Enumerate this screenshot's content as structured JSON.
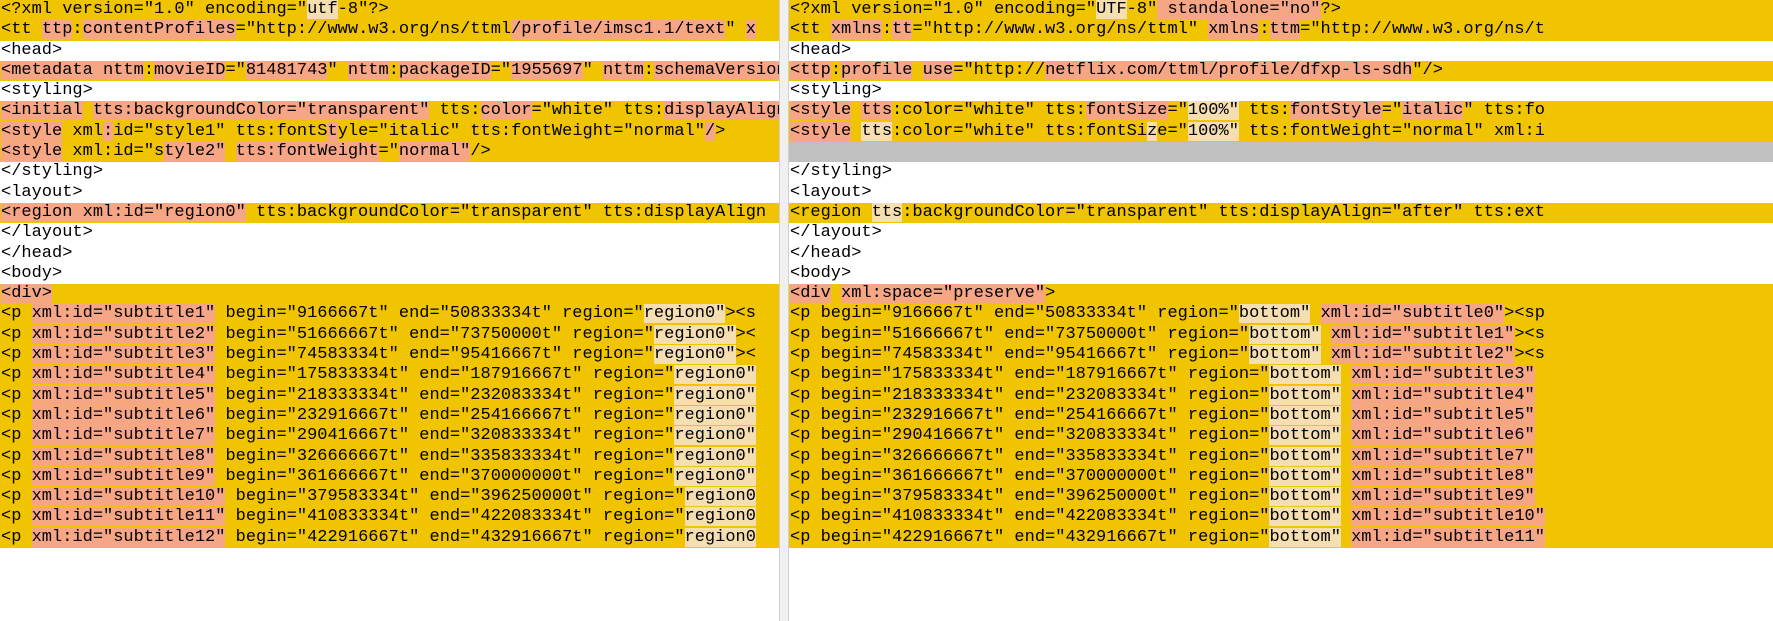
{
  "colors": {
    "changed_line": "#f0c400",
    "deleted_text": "#f6a585",
    "modified_text": "#f5deb0",
    "blank_line": "#c0c0c0",
    "background": "#ffffff"
  },
  "left_pane": {
    "lines": [
      {
        "s": "changed",
        "t": [
          [
            "n",
            "<?xml version=\"1.0\" encoding=\""
          ],
          [
            "m",
            "utf"
          ],
          [
            "n",
            "-8\"?>"
          ]
        ]
      },
      {
        "s": "changed",
        "t": [
          [
            "n",
            "<tt "
          ],
          [
            "d",
            "ttp"
          ],
          [
            "n",
            ":"
          ],
          [
            "d",
            "contentProfiles"
          ],
          [
            "n",
            "=\"http://www.w3.org/ns/ttml"
          ],
          [
            "d",
            "/profile/imsc1.1/text"
          ],
          [
            "n",
            "\" "
          ],
          [
            "d",
            "x"
          ]
        ]
      },
      {
        "s": "plain",
        "t": [
          [
            "n",
            "<head>"
          ]
        ]
      },
      {
        "s": "changed",
        "t": [
          [
            "d",
            "<metadata nttm"
          ],
          [
            "n",
            ":"
          ],
          [
            "d",
            "movieID"
          ],
          [
            "n",
            "=\""
          ],
          [
            "d",
            "81481743"
          ],
          [
            "n",
            "\" "
          ],
          [
            "d",
            "nttm"
          ],
          [
            "n",
            ":"
          ],
          [
            "d",
            "packageID"
          ],
          [
            "n",
            "=\""
          ],
          [
            "d",
            "1955697"
          ],
          [
            "n",
            "\" "
          ],
          [
            "d",
            "nttm"
          ],
          [
            "n",
            ":"
          ],
          [
            "d",
            "schemaVersion"
          ]
        ]
      },
      {
        "s": "plain",
        "t": [
          [
            "n",
            "<styling>"
          ]
        ]
      },
      {
        "s": "changed",
        "t": [
          [
            "d",
            "<initial"
          ],
          [
            "n",
            " "
          ],
          [
            "d",
            "tts:backgroundColor=\"transparent\""
          ],
          [
            "n",
            " tts:"
          ],
          [
            "d",
            "color"
          ],
          [
            "n",
            "=\"white\" tts:"
          ],
          [
            "d",
            "displayAlign"
          ]
        ]
      },
      {
        "s": "changed",
        "t": [
          [
            "d",
            "<style"
          ],
          [
            "n",
            " xml"
          ],
          [
            "d",
            ":"
          ],
          [
            "n",
            "id=\"style1\" tts:fontS"
          ],
          [
            "d",
            "t"
          ],
          [
            "n",
            "yle=\"italic\" tts:fontWeight=\"normal\""
          ],
          [
            "d",
            "/"
          ],
          [
            "n",
            ">"
          ]
        ]
      },
      {
        "s": "changed",
        "t": [
          [
            "d",
            "<style"
          ],
          [
            "n",
            " xml:id=\"s"
          ],
          [
            "d",
            "tyle2\""
          ],
          [
            "n",
            " "
          ],
          [
            "d",
            "tts:fontWeight"
          ],
          [
            "n",
            "=\""
          ],
          [
            "d",
            "normal\""
          ],
          [
            "n",
            "/>"
          ]
        ]
      },
      {
        "s": "plain",
        "t": [
          [
            "n",
            "</styling>"
          ]
        ]
      },
      {
        "s": "plain",
        "t": [
          [
            "n",
            "<layout>"
          ]
        ]
      },
      {
        "s": "changed",
        "t": [
          [
            "d",
            "<region xml:id=\"region0\""
          ],
          [
            "n",
            " tts:backgroundColor=\"transparent\" tts:displayAlign"
          ]
        ]
      },
      {
        "s": "plain",
        "t": [
          [
            "n",
            "</layout>"
          ]
        ]
      },
      {
        "s": "plain",
        "t": [
          [
            "n",
            "</head>"
          ]
        ]
      },
      {
        "s": "plain",
        "t": [
          [
            "n",
            "<body>"
          ]
        ]
      },
      {
        "s": "changed",
        "t": [
          [
            "d",
            "<div>"
          ]
        ]
      },
      {
        "s": "changed",
        "t": [
          [
            "n",
            "<p "
          ],
          [
            "d",
            "xml:id=\"subtitle1\""
          ],
          [
            "n",
            " begin=\"9166667t\" end=\"50833334t\" region=\""
          ],
          [
            "m",
            "region0\""
          ],
          [
            "n",
            "><s"
          ]
        ]
      },
      {
        "s": "changed",
        "t": [
          [
            "n",
            "<p "
          ],
          [
            "d",
            "xml:id=\"subtitle2\""
          ],
          [
            "n",
            " begin=\"51666667t\" end=\"73750000t\" region=\""
          ],
          [
            "m",
            "region0\""
          ],
          [
            "n",
            "><"
          ]
        ]
      },
      {
        "s": "changed",
        "t": [
          [
            "n",
            "<p "
          ],
          [
            "d",
            "xml:id=\"subtitle3\""
          ],
          [
            "n",
            " begin=\"74583334t\" end=\"95416667t\" region=\""
          ],
          [
            "m",
            "region0\""
          ],
          [
            "n",
            "><"
          ]
        ]
      },
      {
        "s": "changed",
        "t": [
          [
            "n",
            "<p "
          ],
          [
            "d",
            "xml:id=\"subtitle4\""
          ],
          [
            "n",
            " begin=\"175833334t\" end=\"187916667t\" region=\""
          ],
          [
            "m",
            "region0\""
          ]
        ]
      },
      {
        "s": "changed",
        "t": [
          [
            "n",
            "<p "
          ],
          [
            "d",
            "xml:id=\"subtitle5\""
          ],
          [
            "n",
            " begin=\"218333334t\" end=\"232083334t\" region=\""
          ],
          [
            "m",
            "region0\""
          ]
        ]
      },
      {
        "s": "changed",
        "t": [
          [
            "n",
            "<p "
          ],
          [
            "d",
            "xml:id=\"subtitle6\""
          ],
          [
            "n",
            " begin=\"232916667t\" end=\"254166667t\" region=\""
          ],
          [
            "m",
            "region0\""
          ]
        ]
      },
      {
        "s": "changed",
        "t": [
          [
            "n",
            "<p "
          ],
          [
            "d",
            "xml:id=\"subtitle7\""
          ],
          [
            "n",
            " begin=\"290416667t\" end=\"320833334t\" region=\""
          ],
          [
            "m",
            "region0\""
          ]
        ]
      },
      {
        "s": "changed",
        "t": [
          [
            "n",
            "<p "
          ],
          [
            "d",
            "xml:id=\"subtitle8\""
          ],
          [
            "n",
            " begin=\"326666667t\" end=\"335833334t\" region=\""
          ],
          [
            "m",
            "region0\""
          ]
        ]
      },
      {
        "s": "changed",
        "t": [
          [
            "n",
            "<p "
          ],
          [
            "d",
            "xml:id=\"subtitle9\""
          ],
          [
            "n",
            " begin=\"361666667t\" end=\"370000000t\" region=\""
          ],
          [
            "m",
            "region0\""
          ]
        ]
      },
      {
        "s": "changed",
        "t": [
          [
            "n",
            "<p "
          ],
          [
            "d",
            "xml:id=\"subtitle10\""
          ],
          [
            "n",
            " begin=\"379583334t\" end=\"396250000t\" region=\""
          ],
          [
            "m",
            "region0"
          ]
        ]
      },
      {
        "s": "changed",
        "t": [
          [
            "n",
            "<p "
          ],
          [
            "d",
            "xml:id=\"subtitle11\""
          ],
          [
            "n",
            " begin=\"410833334t\" end=\"422083334t\" region=\""
          ],
          [
            "m",
            "region0"
          ]
        ]
      },
      {
        "s": "changed",
        "t": [
          [
            "n",
            "<p "
          ],
          [
            "d",
            "xml:id=\"subtitle12\""
          ],
          [
            "n",
            " begin=\"422916667t\" end=\"432916667t\" region=\""
          ],
          [
            "m",
            "region0"
          ]
        ]
      }
    ]
  },
  "right_pane": {
    "lines": [
      {
        "s": "changed",
        "t": [
          [
            "n",
            "<?xml version=\"1.0\" encoding=\""
          ],
          [
            "m",
            "UTF"
          ],
          [
            "n",
            "-8\""
          ],
          [
            "d",
            " standalone=\"no\""
          ],
          [
            "n",
            "?>"
          ]
        ]
      },
      {
        "s": "changed",
        "t": [
          [
            "n",
            "<tt "
          ],
          [
            "d",
            "xmlns"
          ],
          [
            "n",
            ":"
          ],
          [
            "d",
            "tt"
          ],
          [
            "n",
            "=\"http://www.w3.org/ns/ttml\" "
          ],
          [
            "d",
            "xmlns"
          ],
          [
            "n",
            ":"
          ],
          [
            "d",
            "ttm"
          ],
          [
            "n",
            "=\"http://www.w3.org/ns/t"
          ]
        ]
      },
      {
        "s": "plain",
        "t": [
          [
            "n",
            "<head>"
          ]
        ]
      },
      {
        "s": "changed",
        "t": [
          [
            "d",
            "<ttp"
          ],
          [
            "n",
            ":"
          ],
          [
            "d",
            "profile"
          ],
          [
            "n",
            " "
          ],
          [
            "d",
            "use"
          ],
          [
            "n",
            "=\"http://"
          ],
          [
            "d",
            "netflix.com/ttml/profile/dfxp-ls-sdh"
          ],
          [
            "n",
            "\"/>"
          ]
        ]
      },
      {
        "s": "plain",
        "t": [
          [
            "n",
            "<styling>"
          ]
        ]
      },
      {
        "s": "changed",
        "t": [
          [
            "d",
            "<style"
          ],
          [
            "n",
            " "
          ],
          [
            "d",
            "tts"
          ],
          [
            "n",
            ":color=\"white\" tts:"
          ],
          [
            "d",
            "fontSize"
          ],
          [
            "n",
            "=\""
          ],
          [
            "m",
            "100%\""
          ],
          [
            "n",
            " tts:"
          ],
          [
            "d",
            "fontStyle"
          ],
          [
            "n",
            "=\""
          ],
          [
            "d",
            "italic"
          ],
          [
            "n",
            "\" tts:fo"
          ]
        ]
      },
      {
        "s": "changed",
        "t": [
          [
            "d",
            "<style"
          ],
          [
            "n",
            " "
          ],
          [
            "m",
            "tts"
          ],
          [
            "n",
            ":color=\"white\" tts:fontSi"
          ],
          [
            "m",
            "z"
          ],
          [
            "n",
            "e=\""
          ],
          [
            "m",
            "100%\""
          ],
          [
            "n",
            " tts:fontWeight=\"normal\" xml:i"
          ]
        ]
      },
      {
        "s": "blank",
        "t": []
      },
      {
        "s": "plain",
        "t": [
          [
            "n",
            "</styling>"
          ]
        ]
      },
      {
        "s": "plain",
        "t": [
          [
            "n",
            "<layout>"
          ]
        ]
      },
      {
        "s": "changed",
        "t": [
          [
            "n",
            "<region "
          ],
          [
            "m",
            "tts"
          ],
          [
            "n",
            ":backgroundColor=\"transparent\" tts:displayAlign=\"after\" tts:ext"
          ]
        ]
      },
      {
        "s": "plain",
        "t": [
          [
            "n",
            "</layout>"
          ]
        ]
      },
      {
        "s": "plain",
        "t": [
          [
            "n",
            "</head>"
          ]
        ]
      },
      {
        "s": "plain",
        "t": [
          [
            "n",
            "<body>"
          ]
        ]
      },
      {
        "s": "changed",
        "t": [
          [
            "d",
            "<div"
          ],
          [
            "n",
            " "
          ],
          [
            "d",
            "xml:space=\"preserve\""
          ],
          [
            "n",
            ">"
          ]
        ]
      },
      {
        "s": "changed",
        "t": [
          [
            "n",
            "<p begin=\"9166667t\" end=\"50833334t\" region=\""
          ],
          [
            "m",
            "bottom\""
          ],
          [
            "n",
            " "
          ],
          [
            "d",
            "xml:id=\"subtitle0\""
          ],
          [
            "n",
            "><sp"
          ]
        ]
      },
      {
        "s": "changed",
        "t": [
          [
            "n",
            "<p begin=\"51666667t\" end=\"73750000t\" region=\""
          ],
          [
            "m",
            "bottom\""
          ],
          [
            "n",
            " "
          ],
          [
            "d",
            "xml:id=\"subtitle1\""
          ],
          [
            "n",
            "><s"
          ]
        ]
      },
      {
        "s": "changed",
        "t": [
          [
            "n",
            "<p begin=\"74583334t\" end=\"95416667t\" region=\""
          ],
          [
            "m",
            "bottom\""
          ],
          [
            "n",
            " "
          ],
          [
            "d",
            "xml:id=\"subtitle2\""
          ],
          [
            "n",
            "><s"
          ]
        ]
      },
      {
        "s": "changed",
        "t": [
          [
            "n",
            "<p begin=\"175833334t\" end=\"187916667t\" region=\""
          ],
          [
            "m",
            "bottom\""
          ],
          [
            "n",
            " "
          ],
          [
            "d",
            "xml:id=\"subtitle3\""
          ]
        ]
      },
      {
        "s": "changed",
        "t": [
          [
            "n",
            "<p begin=\"218333334t\" end=\"232083334t\" region=\""
          ],
          [
            "m",
            "bottom\""
          ],
          [
            "n",
            " "
          ],
          [
            "d",
            "xml:id=\"subtitle4\""
          ]
        ]
      },
      {
        "s": "changed",
        "t": [
          [
            "n",
            "<p begin=\"232916667t\" end=\"254166667t\" region=\""
          ],
          [
            "m",
            "bottom\""
          ],
          [
            "n",
            " "
          ],
          [
            "d",
            "xml:id=\"subtitle5\""
          ]
        ]
      },
      {
        "s": "changed",
        "t": [
          [
            "n",
            "<p begin=\"290416667t\" end=\"320833334t\" region=\""
          ],
          [
            "m",
            "bottom\""
          ],
          [
            "n",
            " "
          ],
          [
            "d",
            "xml:id=\"subtitle6\""
          ]
        ]
      },
      {
        "s": "changed",
        "t": [
          [
            "n",
            "<p begin=\"326666667t\" end=\"335833334t\" region=\""
          ],
          [
            "m",
            "bottom\""
          ],
          [
            "n",
            " "
          ],
          [
            "d",
            "xml:id=\"subtitle7\""
          ]
        ]
      },
      {
        "s": "changed",
        "t": [
          [
            "n",
            "<p begin=\"361666667t\" end=\"370000000t\" region=\""
          ],
          [
            "m",
            "bottom\""
          ],
          [
            "n",
            " "
          ],
          [
            "d",
            "xml:id=\"subtitle8\""
          ]
        ]
      },
      {
        "s": "changed",
        "t": [
          [
            "n",
            "<p begin=\"379583334t\" end=\"396250000t\" region=\""
          ],
          [
            "m",
            "bottom\""
          ],
          [
            "n",
            " "
          ],
          [
            "d",
            "xml:id=\"subtitle9\""
          ]
        ]
      },
      {
        "s": "changed",
        "t": [
          [
            "n",
            "<p begin=\"410833334t\" end=\"422083334t\" region=\""
          ],
          [
            "m",
            "bottom\""
          ],
          [
            "n",
            " "
          ],
          [
            "d",
            "xml:id=\"subtitle10\""
          ]
        ]
      },
      {
        "s": "changed",
        "t": [
          [
            "n",
            "<p begin=\"422916667t\" end=\"432916667t\" region=\""
          ],
          [
            "m",
            "bottom\""
          ],
          [
            "n",
            " "
          ],
          [
            "d",
            "xml:id=\"subtitle11\""
          ]
        ]
      }
    ]
  }
}
